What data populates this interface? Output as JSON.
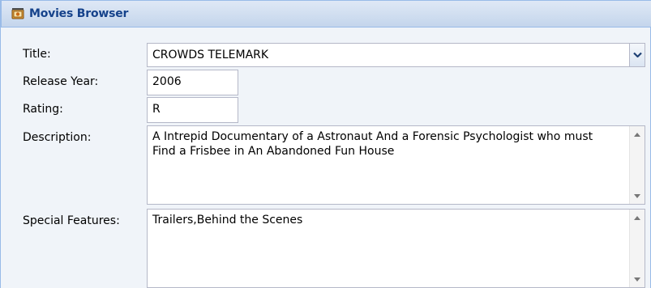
{
  "window": {
    "title": "Movies Browser",
    "icon": "film-icon"
  },
  "form": {
    "title_label": "Title:",
    "title_value": "CROWDS TELEMARK",
    "release_year_label": "Release Year:",
    "release_year_value": "2006",
    "rating_label": "Rating:",
    "rating_value": "R",
    "description_label": "Description:",
    "description_value": "A Intrepid Documentary of a Astronaut And a Forensic Psychologist who must Find a Frisbee in An Abandoned Fun House",
    "special_features_label": "Special Features:",
    "special_features_value": "Trailers,Behind the Scenes"
  },
  "colors": {
    "header_text": "#15428b",
    "panel_border": "#99bbe8",
    "field_border": "#b5b8c8"
  }
}
